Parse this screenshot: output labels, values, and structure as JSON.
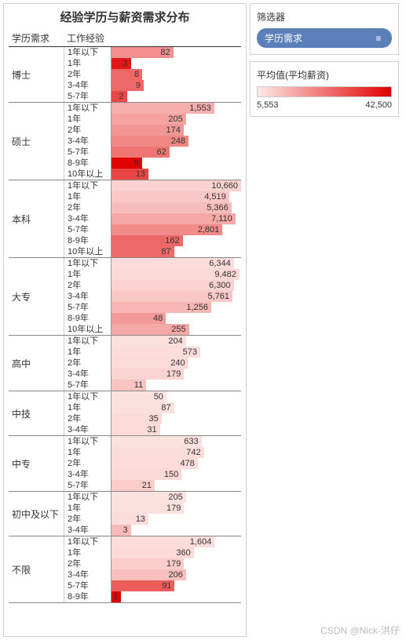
{
  "title": "经验学历与薪资需求分布",
  "header": {
    "edu": "学历需求",
    "exp": "工作经验"
  },
  "filter": {
    "title": "筛选器",
    "pill": "学历需求"
  },
  "legend": {
    "title": "平均值(平均薪资)",
    "min": "5,553",
    "max": "42,500"
  },
  "watermark": "CSDN @Nick-洪仔",
  "chart_data": {
    "type": "bar",
    "xlabel": "工作经验",
    "ylabel": "学历需求",
    "color_metric": "平均值(平均薪资)",
    "color_range": [
      5553,
      42500
    ],
    "groups": [
      {
        "edu": "博士",
        "rows": [
          {
            "exp": "1年以下",
            "value": 82,
            "intensity": 0.38
          },
          {
            "exp": "1年",
            "value": 3,
            "intensity": 0.9
          },
          {
            "exp": "2年",
            "value": 8,
            "intensity": 0.55
          },
          {
            "exp": "3-4年",
            "value": 9,
            "intensity": 0.55
          },
          {
            "exp": "5-7年",
            "value": 2,
            "intensity": 0.7
          }
        ]
      },
      {
        "edu": "硕士",
        "rows": [
          {
            "exp": "1年以下",
            "value": 1553,
            "intensity": 0.25
          },
          {
            "exp": "1年",
            "value": 205,
            "intensity": 0.3
          },
          {
            "exp": "2年",
            "value": 174,
            "intensity": 0.35
          },
          {
            "exp": "3-4年",
            "value": 248,
            "intensity": 0.42
          },
          {
            "exp": "5-7年",
            "value": 62,
            "intensity": 0.5
          },
          {
            "exp": "8-9年",
            "value": 8,
            "intensity": 1.0
          },
          {
            "exp": "10年以上",
            "value": 13,
            "intensity": 0.7
          }
        ]
      },
      {
        "edu": "本科",
        "rows": [
          {
            "exp": "1年以下",
            "value": 10660,
            "intensity": 0.1
          },
          {
            "exp": "1年",
            "value": 4519,
            "intensity": 0.14
          },
          {
            "exp": "2年",
            "value": 5366,
            "intensity": 0.19
          },
          {
            "exp": "3-4年",
            "value": 7110,
            "intensity": 0.28
          },
          {
            "exp": "5-7年",
            "value": 2801,
            "intensity": 0.4
          },
          {
            "exp": "8-9年",
            "value": 162,
            "intensity": 0.55
          },
          {
            "exp": "10年以上",
            "value": 87,
            "intensity": 0.55
          }
        ]
      },
      {
        "edu": "大专",
        "rows": [
          {
            "exp": "1年以下",
            "value": 6344,
            "intensity": 0.05
          },
          {
            "exp": "1年",
            "value": 9482,
            "intensity": 0.07
          },
          {
            "exp": "2年",
            "value": 6300,
            "intensity": 0.1
          },
          {
            "exp": "3-4年",
            "value": 5761,
            "intensity": 0.14
          },
          {
            "exp": "5-7年",
            "value": 1256,
            "intensity": 0.22
          },
          {
            "exp": "8-9年",
            "value": 48,
            "intensity": 0.34
          },
          {
            "exp": "10年以上",
            "value": 255,
            "intensity": 0.28
          }
        ]
      },
      {
        "edu": "高中",
        "rows": [
          {
            "exp": "1年以下",
            "value": 204,
            "intensity": 0.04
          },
          {
            "exp": "1年",
            "value": 573,
            "intensity": 0.05
          },
          {
            "exp": "2年",
            "value": 240,
            "intensity": 0.06
          },
          {
            "exp": "3-4年",
            "value": 179,
            "intensity": 0.09
          },
          {
            "exp": "5-7年",
            "value": 11,
            "intensity": 0.16
          }
        ]
      },
      {
        "edu": "中技",
        "rows": [
          {
            "exp": "1年以下",
            "value": 50,
            "intensity": 0.03
          },
          {
            "exp": "1年",
            "value": 87,
            "intensity": 0.04
          },
          {
            "exp": "2年",
            "value": 35,
            "intensity": 0.06
          },
          {
            "exp": "3-4年",
            "value": 31,
            "intensity": 0.06
          }
        ]
      },
      {
        "edu": "中专",
        "rows": [
          {
            "exp": "1年以下",
            "value": 633,
            "intensity": 0.03
          },
          {
            "exp": "1年",
            "value": 742,
            "intensity": 0.05
          },
          {
            "exp": "2年",
            "value": 478,
            "intensity": 0.05
          },
          {
            "exp": "3-4年",
            "value": 150,
            "intensity": 0.07
          },
          {
            "exp": "5-7年",
            "value": 21,
            "intensity": 0.12
          }
        ]
      },
      {
        "edu": "初中及以下",
        "rows": [
          {
            "exp": "1年以下",
            "value": 205,
            "intensity": 0.03
          },
          {
            "exp": "1年",
            "value": 179,
            "intensity": 0.04
          },
          {
            "exp": "2年",
            "value": 13,
            "intensity": 0.05
          },
          {
            "exp": "3-4年",
            "value": 3,
            "intensity": 0.2
          }
        ]
      },
      {
        "edu": "不限",
        "rows": [
          {
            "exp": "1年以下",
            "value": 1604,
            "intensity": 0.05
          },
          {
            "exp": "1年",
            "value": 360,
            "intensity": 0.07
          },
          {
            "exp": "2年",
            "value": 179,
            "intensity": 0.12
          },
          {
            "exp": "3-4年",
            "value": 206,
            "intensity": 0.18
          },
          {
            "exp": "5-7年",
            "value": 91,
            "intensity": 0.6
          },
          {
            "exp": "8-9年",
            "value": 1,
            "intensity": 1.0
          }
        ]
      }
    ]
  }
}
